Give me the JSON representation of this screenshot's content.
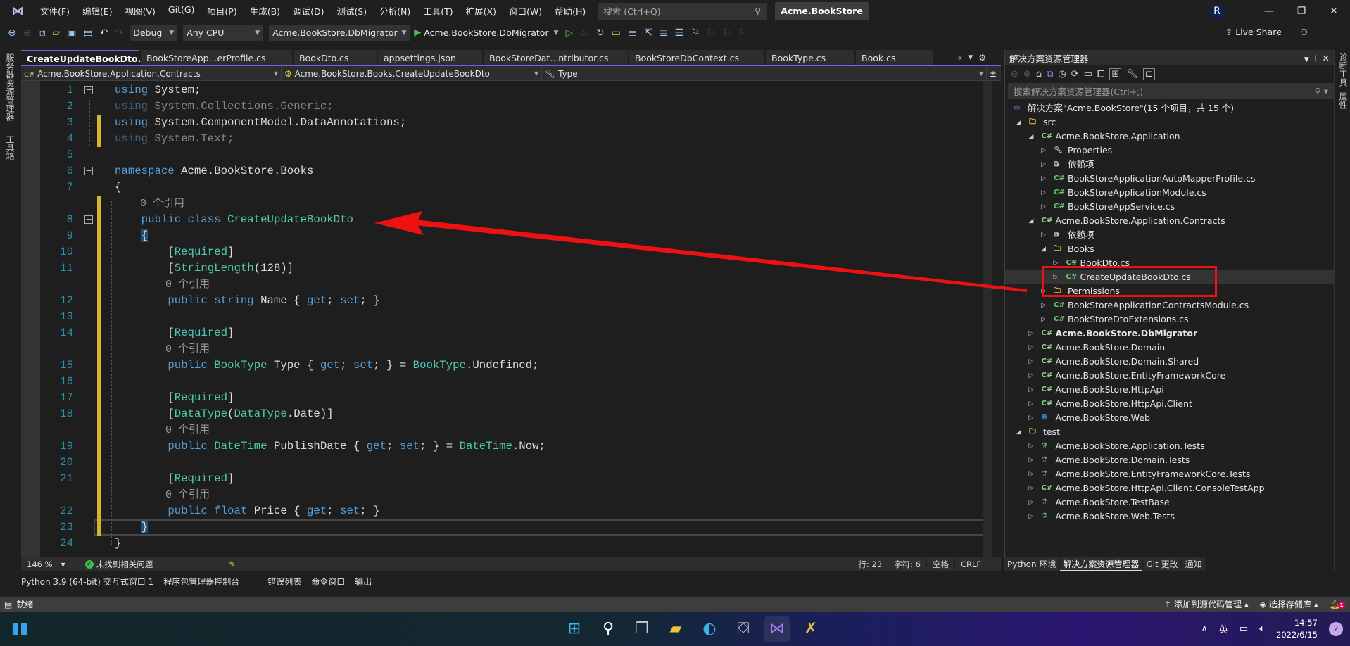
{
  "menubar": {
    "logo": "visual-studio-logo",
    "items": [
      "文件(F)",
      "编辑(E)",
      "视图(V)",
      "Git(G)",
      "项目(P)",
      "生成(B)",
      "调试(D)",
      "测试(S)",
      "分析(N)",
      "工具(T)",
      "扩展(X)",
      "窗口(W)",
      "帮助(H)"
    ],
    "search_placeholder": "搜索 (Ctrl+Q)",
    "app_title": "Acme.BookStore",
    "avatar": "R"
  },
  "toolbar": {
    "config": "Debug",
    "platform": "Any CPU",
    "startup_project": "Acme.BookStore.DbMigrator",
    "run_label": "Acme.BookStore.DbMigrator",
    "live_share": "Live Share"
  },
  "left_strip": [
    "服务器资源管理器",
    "工具箱"
  ],
  "tabs": [
    {
      "label": "CreateUpdateBookDto.cs*",
      "active": true
    },
    {
      "label": "BookStoreApp...erProfile.cs"
    },
    {
      "label": "BookDto.cs"
    },
    {
      "label": "appsettings.json"
    },
    {
      "label": "BookStoreDat...ntributor.cs"
    },
    {
      "label": "BookStoreDbContext.cs"
    },
    {
      "label": "BookType.cs"
    },
    {
      "label": "Book.cs"
    }
  ],
  "navbar": {
    "project": "Acme.BookStore.Application.Contracts",
    "type": "Acme.BookStore.Books.CreateUpdateBookDto",
    "member": "Type"
  },
  "code": [
    {
      "n": "1",
      "fold": true,
      "t": [
        [
          "kw",
          "using"
        ],
        [
          "pl",
          " System;"
        ]
      ]
    },
    {
      "n": "2",
      "dim": true,
      "t": [
        [
          "kw",
          "using"
        ],
        [
          "pl",
          " System.Collections.Generic;"
        ]
      ]
    },
    {
      "n": "3",
      "chg": true,
      "t": [
        [
          "kw",
          "using"
        ],
        [
          "pl",
          " System.ComponentModel.DataAnnotations;"
        ]
      ]
    },
    {
      "n": "4",
      "chg": true,
      "dim": true,
      "t": [
        [
          "kw",
          "using"
        ],
        [
          "pl",
          " System.Text;"
        ]
      ]
    },
    {
      "n": "5",
      "t": []
    },
    {
      "n": "6",
      "fold": true,
      "t": [
        [
          "kw",
          "namespace"
        ],
        [
          "pl",
          " Acme.BookStore.Books"
        ]
      ]
    },
    {
      "n": "7",
      "t": [
        [
          "pl",
          "{"
        ]
      ]
    },
    {
      "n": "",
      "chg": true,
      "t": [
        [
          "lens",
          "    0 个引用"
        ]
      ]
    },
    {
      "n": "8",
      "chg": true,
      "fold": true,
      "t": [
        [
          "pl",
          "    "
        ],
        [
          "kw",
          "public class "
        ],
        [
          "ty",
          "CreateUpdateBookDto"
        ]
      ]
    },
    {
      "n": "9",
      "chg": true,
      "t": [
        [
          "pl",
          "    "
        ],
        [
          "brace-hl",
          "{"
        ]
      ]
    },
    {
      "n": "10",
      "chg": true,
      "t": [
        [
          "pl",
          "        ["
        ],
        [
          "ty",
          "Required"
        ],
        [
          "pl",
          "]"
        ]
      ]
    },
    {
      "n": "11",
      "chg": true,
      "t": [
        [
          "pl",
          "        ["
        ],
        [
          "ty",
          "StringLength"
        ],
        [
          "pl",
          "(128)]"
        ]
      ]
    },
    {
      "n": "",
      "chg": true,
      "t": [
        [
          "lens",
          "        0 个引用"
        ]
      ]
    },
    {
      "n": "12",
      "chg": true,
      "t": [
        [
          "pl",
          "        "
        ],
        [
          "kw",
          "public string "
        ],
        [
          "pl",
          "Name { "
        ],
        [
          "kw",
          "get"
        ],
        [
          "pl",
          "; "
        ],
        [
          "kw",
          "set"
        ],
        [
          "pl",
          "; }"
        ]
      ]
    },
    {
      "n": "13",
      "chg": true,
      "t": []
    },
    {
      "n": "14",
      "chg": true,
      "t": [
        [
          "pl",
          "        ["
        ],
        [
          "ty",
          "Required"
        ],
        [
          "pl",
          "]"
        ]
      ]
    },
    {
      "n": "",
      "chg": true,
      "t": [
        [
          "lens",
          "        0 个引用"
        ]
      ]
    },
    {
      "n": "15",
      "chg": true,
      "t": [
        [
          "pl",
          "        "
        ],
        [
          "kw",
          "public "
        ],
        [
          "ty",
          "BookType"
        ],
        [
          "pl",
          " Type { "
        ],
        [
          "kw",
          "get"
        ],
        [
          "pl",
          "; "
        ],
        [
          "kw",
          "set"
        ],
        [
          "pl",
          "; } = "
        ],
        [
          "ty",
          "BookType"
        ],
        [
          "pl",
          ".Undefined;"
        ]
      ]
    },
    {
      "n": "16",
      "chg": true,
      "t": []
    },
    {
      "n": "17",
      "chg": true,
      "t": [
        [
          "pl",
          "        ["
        ],
        [
          "ty",
          "Required"
        ],
        [
          "pl",
          "]"
        ]
      ]
    },
    {
      "n": "18",
      "chg": true,
      "t": [
        [
          "pl",
          "        ["
        ],
        [
          "ty",
          "DataType"
        ],
        [
          "pl",
          "("
        ],
        [
          "ty",
          "DataType"
        ],
        [
          "pl",
          ".Date)]"
        ]
      ]
    },
    {
      "n": "",
      "chg": true,
      "t": [
        [
          "lens",
          "        0 个引用"
        ]
      ]
    },
    {
      "n": "19",
      "chg": true,
      "t": [
        [
          "pl",
          "        "
        ],
        [
          "kw",
          "public "
        ],
        [
          "ty",
          "DateTime"
        ],
        [
          "pl",
          " PublishDate { "
        ],
        [
          "kw",
          "get"
        ],
        [
          "pl",
          "; "
        ],
        [
          "kw",
          "set"
        ],
        [
          "pl",
          "; } = "
        ],
        [
          "ty",
          "DateTime"
        ],
        [
          "pl",
          ".Now;"
        ]
      ]
    },
    {
      "n": "20",
      "chg": true,
      "t": []
    },
    {
      "n": "21",
      "chg": true,
      "t": [
        [
          "pl",
          "        ["
        ],
        [
          "ty",
          "Required"
        ],
        [
          "pl",
          "]"
        ]
      ]
    },
    {
      "n": "",
      "chg": true,
      "t": [
        [
          "lens",
          "        0 个引用"
        ]
      ]
    },
    {
      "n": "22",
      "chg": true,
      "t": [
        [
          "pl",
          "        "
        ],
        [
          "kw",
          "public float "
        ],
        [
          "pl",
          "Price { "
        ],
        [
          "kw",
          "get"
        ],
        [
          "pl",
          "; "
        ],
        [
          "kw",
          "set"
        ],
        [
          "pl",
          "; }"
        ]
      ]
    },
    {
      "n": "23",
      "chg": true,
      "cur": true,
      "t": [
        [
          "pl",
          "    "
        ],
        [
          "brace-hl",
          "}"
        ]
      ]
    },
    {
      "n": "24",
      "t": [
        [
          "pl",
          "}"
        ]
      ]
    }
  ],
  "editor_status": {
    "zoom": "146 %",
    "issues": "未找到相关问题",
    "line": "行: 23",
    "col": "字符: 6",
    "indent": "空格",
    "eol": "CRLF"
  },
  "bottom_tabs": [
    "Python 3.9 (64-bit) 交互式窗口 1",
    "程序包管理器控制台",
    "错误列表",
    "命令窗口",
    "输出"
  ],
  "statusbar": {
    "ready": "就绪",
    "add_source": "添加到源代码管理",
    "select_repo": "选择存储库",
    "bell_count": "1"
  },
  "solution_explorer": {
    "title": "解决方案资源管理器",
    "search_placeholder": "搜索解决方案资源管理器(Ctrl+;)",
    "tree": [
      {
        "d": 0,
        "icon": "solution",
        "label": "解决方案\"Acme.BookStore\"(15 个项目，共 15 个)"
      },
      {
        "d": 0,
        "arrow": "open",
        "icon": "folder",
        "label": "src"
      },
      {
        "d": 1,
        "arrow": "open",
        "icon": "csproj",
        "label": "Acme.BookStore.Application"
      },
      {
        "d": 2,
        "arrow": "closed",
        "icon": "properties",
        "label": "Properties"
      },
      {
        "d": 2,
        "arrow": "closed",
        "icon": "dependencies",
        "label": "依赖项"
      },
      {
        "d": 2,
        "arrow": "closed",
        "icon": "csfile",
        "label": "BookStoreApplicationAutoMapperProfile.cs"
      },
      {
        "d": 2,
        "arrow": "closed",
        "icon": "csfile",
        "label": "BookStoreApplicationModule.cs"
      },
      {
        "d": 2,
        "arrow": "closed",
        "icon": "csfile",
        "label": "BookStoreAppService.cs"
      },
      {
        "d": 1,
        "arrow": "open",
        "icon": "csproj",
        "label": "Acme.BookStore.Application.Contracts"
      },
      {
        "d": 2,
        "arrow": "closed",
        "icon": "dependencies",
        "label": "依赖项"
      },
      {
        "d": 2,
        "arrow": "open",
        "icon": "folder",
        "label": "Books"
      },
      {
        "d": 3,
        "arrow": "closed",
        "icon": "csfile",
        "label": "BookDto.cs"
      },
      {
        "d": 3,
        "arrow": "closed",
        "icon": "csfile",
        "label": "CreateUpdateBookDto.cs",
        "selected": true
      },
      {
        "d": 2,
        "arrow": "closed",
        "icon": "folder",
        "label": "Permissions"
      },
      {
        "d": 2,
        "arrow": "closed",
        "icon": "csfile",
        "label": "BookStoreApplicationContractsModule.cs"
      },
      {
        "d": 2,
        "arrow": "closed",
        "icon": "csfile",
        "label": "BookStoreDtoExtensions.cs"
      },
      {
        "d": 1,
        "arrow": "closed",
        "icon": "csproj",
        "label": "Acme.BookStore.DbMigrator",
        "bold": true
      },
      {
        "d": 1,
        "arrow": "closed",
        "icon": "csproj",
        "label": "Acme.BookStore.Domain"
      },
      {
        "d": 1,
        "arrow": "closed",
        "icon": "csproj",
        "label": "Acme.BookStore.Domain.Shared"
      },
      {
        "d": 1,
        "arrow": "closed",
        "icon": "csproj",
        "label": "Acme.BookStore.EntityFrameworkCore"
      },
      {
        "d": 1,
        "arrow": "closed",
        "icon": "csproj",
        "label": "Acme.BookStore.HttpApi"
      },
      {
        "d": 1,
        "arrow": "closed",
        "icon": "csproj",
        "label": "Acme.BookStore.HttpApi.Client"
      },
      {
        "d": 1,
        "arrow": "closed",
        "icon": "webproj",
        "label": "Acme.BookStore.Web"
      },
      {
        "d": 0,
        "arrow": "open",
        "icon": "folder",
        "label": "test"
      },
      {
        "d": 1,
        "arrow": "closed",
        "icon": "testproj",
        "label": "Acme.BookStore.Application.Tests"
      },
      {
        "d": 1,
        "arrow": "closed",
        "icon": "testproj",
        "label": "Acme.BookStore.Domain.Tests"
      },
      {
        "d": 1,
        "arrow": "closed",
        "icon": "testproj",
        "label": "Acme.BookStore.EntityFrameworkCore.Tests"
      },
      {
        "d": 1,
        "arrow": "closed",
        "icon": "csproj",
        "label": "Acme.BookStore.HttpApi.Client.ConsoleTestApp"
      },
      {
        "d": 1,
        "arrow": "closed",
        "icon": "testproj",
        "label": "Acme.BookStore.TestBase"
      },
      {
        "d": 1,
        "arrow": "closed",
        "icon": "testproj",
        "label": "Acme.BookStore.Web.Tests"
      }
    ],
    "bottom_tabs": [
      "Python 环境",
      "解决方案资源管理器",
      "Git 更改",
      "通知"
    ]
  },
  "right_strip": [
    "诊断工具",
    "属性"
  ],
  "taskbar": {
    "time": "14:57",
    "date": "2022/6/15",
    "ime": "英",
    "notifications": "2"
  },
  "annotation": {
    "color": "#ee1111"
  },
  "colors": {
    "accent": "#7160e8",
    "keyword": "#569cd6",
    "type": "#4ec9b0",
    "line_number": "#2b91af",
    "change_bar": "#d4b52c"
  }
}
